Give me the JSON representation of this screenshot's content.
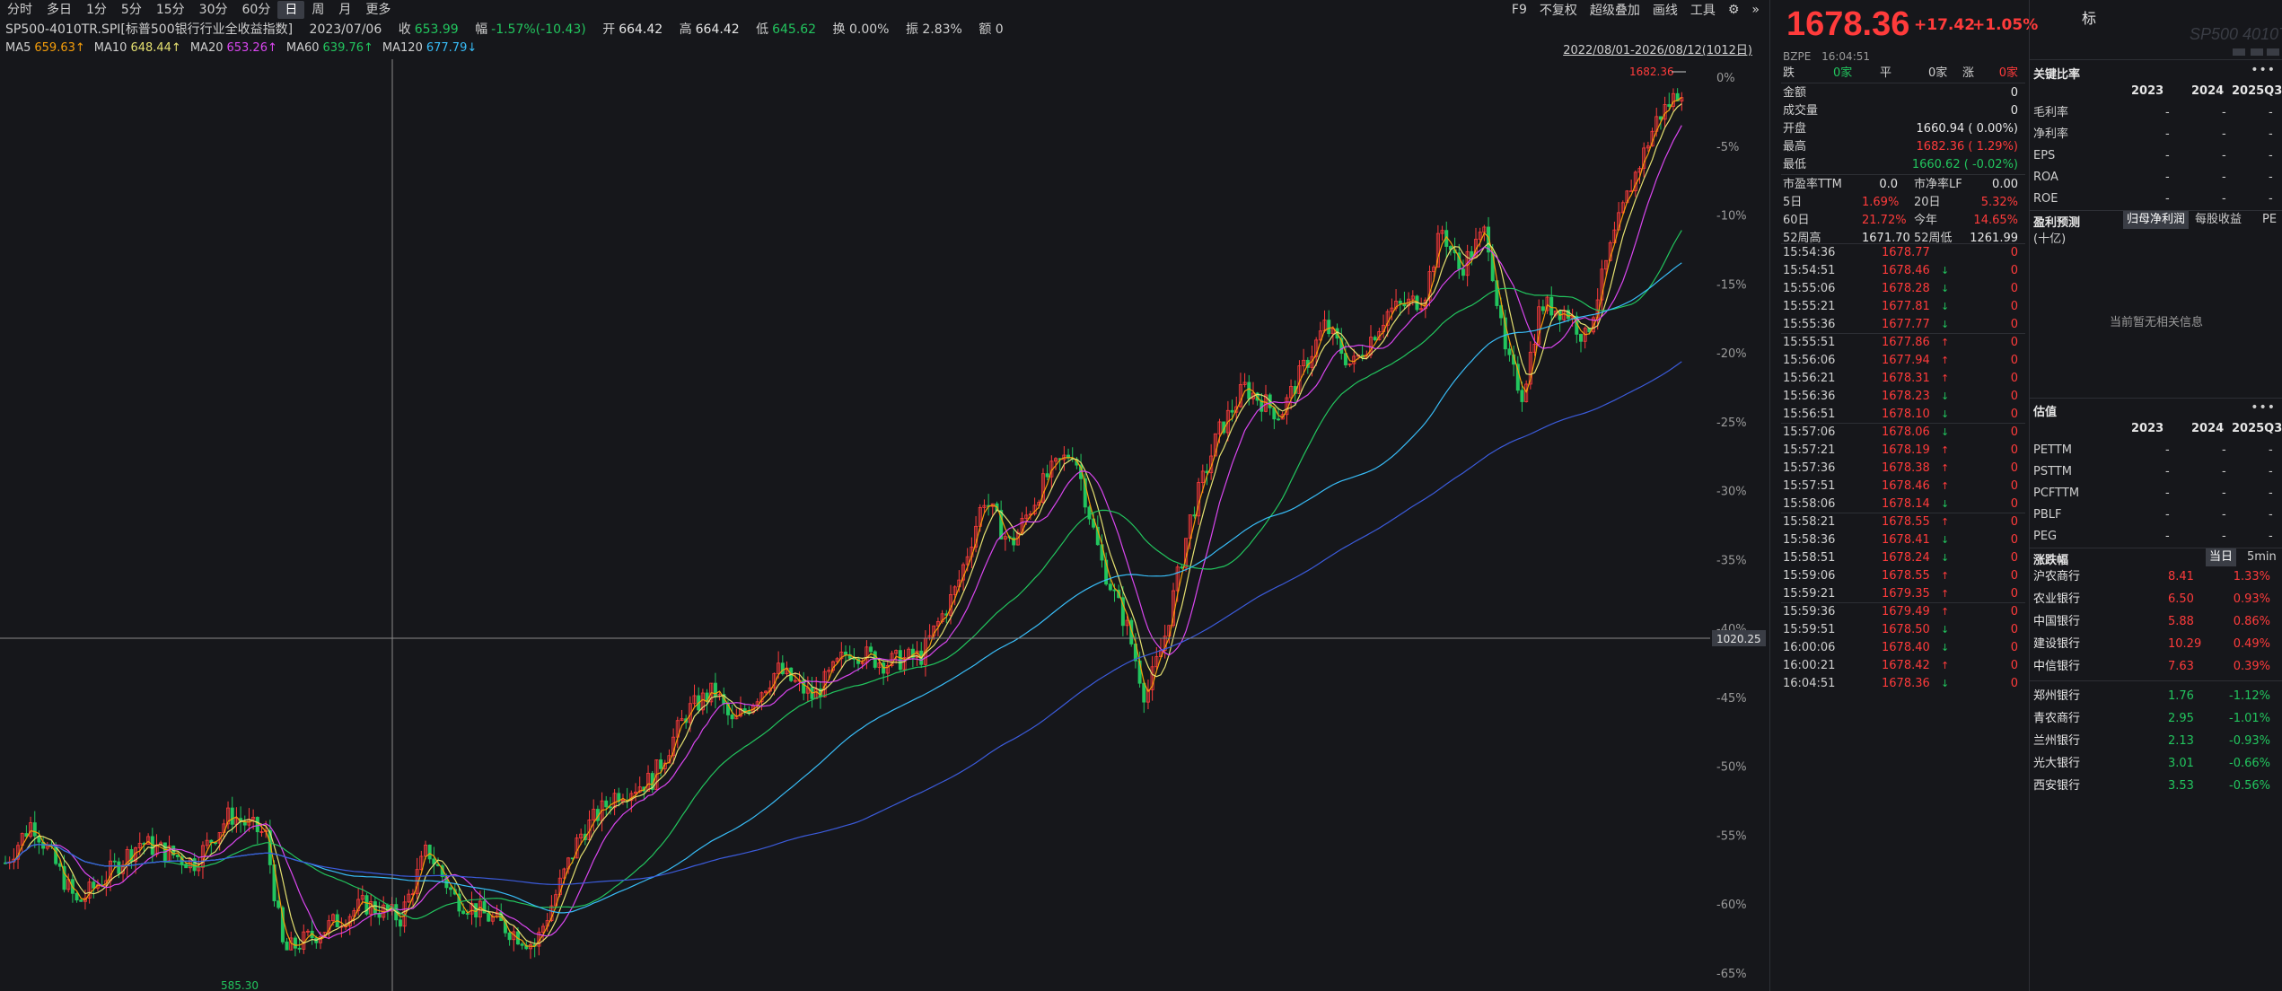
{
  "toolbar": {
    "periods": [
      "分时",
      "多日",
      "1分",
      "5分",
      "15分",
      "30分",
      "60分",
      "日",
      "周",
      "月",
      "更多"
    ],
    "active_period": "日",
    "tools": [
      "F9",
      "不复权",
      "超级叠加",
      "画线",
      "工具"
    ]
  },
  "info": {
    "symbol": "SP500-4010TR.SPI[标普500银行行业全收益指数]",
    "date": "2023/07/06",
    "close_label": "收",
    "close": "653.99",
    "amp_label": "幅",
    "change": "-1.57%(-10.43)",
    "open_label": "开",
    "open": "664.42",
    "high_label": "高",
    "high": "664.42",
    "low_label": "低",
    "low": "645.62",
    "turnover": "换 0.00%",
    "amplitude": "振 2.83%",
    "amount": "额 0"
  },
  "ma": [
    {
      "label": "MA5",
      "value": "659.63↑",
      "color": "#f59e0b"
    },
    {
      "label": "MA10",
      "value": "648.44↑",
      "color": "#e5e070"
    },
    {
      "label": "MA20",
      "value": "653.26↑",
      "color": "#d946ef"
    },
    {
      "label": "MA60",
      "value": "639.76↑",
      "color": "#22c55e"
    },
    {
      "label": "MA120",
      "value": "677.79↓",
      "color": "#38bdf8"
    }
  ],
  "range_label": "2022/08/01-2026/08/12(1012日)",
  "chart": {
    "y_ticks": [
      "0%",
      "-5%",
      "-10%",
      "-15%",
      "-20%",
      "-25%",
      "-30%",
      "-35%",
      "-40%",
      "-45%",
      "-50%",
      "-55%",
      "-60%",
      "-65%"
    ],
    "max_label": "1682.36",
    "min_label": "585.30",
    "crosshair_label": "1020.25",
    "colors": {
      "up": "#ff3b3b",
      "down": "#22c55e",
      "ma5": "#f59e0b",
      "ma10": "#e5e070",
      "ma20": "#d946ef",
      "ma60": "#22c55e",
      "ma120": "#38bdf8",
      "ma250": "#3b5bdb"
    }
  },
  "quote": {
    "price": "1678.36",
    "change": "+17.42",
    "pct": "+1.05%",
    "code": "BZPE",
    "time": "16:04:51",
    "breadth": {
      "down_label": "跌",
      "down": "0家",
      "flat_label": "平",
      "flat": "0家",
      "up_label": "涨",
      "up": "0家"
    },
    "rows": [
      {
        "label": "金额",
        "value": "0"
      },
      {
        "label": "成交量",
        "value": "0"
      },
      {
        "label": "开盘",
        "value": "1660.94 ( 0.00%)"
      },
      {
        "label": "最高",
        "value": "1682.36 ( 1.29%)"
      },
      {
        "label": "最低",
        "value": "1660.62 ( -0.02%)"
      }
    ],
    "valuation": [
      {
        "l1": "市盈率TTM",
        "v1": "0.0",
        "l2": "市净率LF",
        "v2": "0.00"
      },
      {
        "l1": "5日",
        "v1": "1.69%",
        "l2": "20日",
        "v2": "5.32%"
      },
      {
        "l1": "60日",
        "v1": "21.72%",
        "l2": "今年",
        "v2": "14.65%"
      },
      {
        "l1": "52周高",
        "v1": "1671.70",
        "l2": "52周低",
        "v2": "1261.99"
      }
    ],
    "ticks": [
      {
        "time": "15:54:36",
        "price": "1678.77",
        "dir": "",
        "vol": "0"
      },
      {
        "time": "15:54:51",
        "price": "1678.46",
        "dir": "↓",
        "vol": "0"
      },
      {
        "time": "15:55:06",
        "price": "1678.28",
        "dir": "↓",
        "vol": "0"
      },
      {
        "time": "15:55:21",
        "price": "1677.81",
        "dir": "↓",
        "vol": "0"
      },
      {
        "time": "15:55:36",
        "price": "1677.77",
        "dir": "↓",
        "vol": "0"
      },
      {
        "time": "15:55:51",
        "price": "1677.86",
        "dir": "↑",
        "vol": "0"
      },
      {
        "time": "15:56:06",
        "price": "1677.94",
        "dir": "↑",
        "vol": "0"
      },
      {
        "time": "15:56:21",
        "price": "1678.31",
        "dir": "↑",
        "vol": "0"
      },
      {
        "time": "15:56:36",
        "price": "1678.23",
        "dir": "↓",
        "vol": "0"
      },
      {
        "time": "15:56:51",
        "price": "1678.10",
        "dir": "↓",
        "vol": "0"
      },
      {
        "time": "15:57:06",
        "price": "1678.06",
        "dir": "↓",
        "vol": "0"
      },
      {
        "time": "15:57:21",
        "price": "1678.19",
        "dir": "↑",
        "vol": "0"
      },
      {
        "time": "15:57:36",
        "price": "1678.38",
        "dir": "↑",
        "vol": "0"
      },
      {
        "time": "15:57:51",
        "price": "1678.46",
        "dir": "↑",
        "vol": "0"
      },
      {
        "time": "15:58:06",
        "price": "1678.14",
        "dir": "↓",
        "vol": "0"
      },
      {
        "time": "15:58:21",
        "price": "1678.55",
        "dir": "↑",
        "vol": "0"
      },
      {
        "time": "15:58:36",
        "price": "1678.41",
        "dir": "↓",
        "vol": "0"
      },
      {
        "time": "15:58:51",
        "price": "1678.24",
        "dir": "↓",
        "vol": "0"
      },
      {
        "time": "15:59:06",
        "price": "1678.55",
        "dir": "↑",
        "vol": "0"
      },
      {
        "time": "15:59:21",
        "price": "1679.35",
        "dir": "↑",
        "vol": "0"
      },
      {
        "time": "15:59:36",
        "price": "1679.49",
        "dir": "↑",
        "vol": "0"
      },
      {
        "time": "15:59:51",
        "price": "1678.50",
        "dir": "↓",
        "vol": "0"
      },
      {
        "time": "16:00:06",
        "price": "1678.40",
        "dir": "↓",
        "vol": "0"
      },
      {
        "time": "16:00:21",
        "price": "1678.42",
        "dir": "↑",
        "vol": "0"
      },
      {
        "time": "16:04:51",
        "price": "1678.36",
        "dir": "↓",
        "vol": "0"
      }
    ]
  },
  "fundamentals": {
    "key_ratios_title": "关键比率",
    "years": [
      "2023",
      "2024",
      "2025Q3"
    ],
    "key_ratios": [
      {
        "label": "毛利率",
        "vals": [
          "-",
          "-",
          "-"
        ]
      },
      {
        "label": "净利率",
        "vals": [
          "-",
          "-",
          "-"
        ]
      },
      {
        "label": "EPS",
        "vals": [
          "-",
          "-",
          "-"
        ]
      },
      {
        "label": "ROA",
        "vals": [
          "-",
          "-",
          "-"
        ]
      },
      {
        "label": "ROE",
        "vals": [
          "-",
          "-",
          "-"
        ]
      }
    ],
    "forecast_title": "盈利预测",
    "forecast_tabs": [
      "归母净利润",
      "每股收益",
      "PE"
    ],
    "forecast_unit": "(十亿)",
    "no_info": "当前暂无相关信息",
    "valuation_title": "估值",
    "valuation": [
      {
        "label": "PETTM",
        "vals": [
          "-",
          "-",
          "-"
        ]
      },
      {
        "label": "PSTTM",
        "vals": [
          "-",
          "-",
          "-"
        ]
      },
      {
        "label": "PCFTTM",
        "vals": [
          "-",
          "-",
          "-"
        ]
      },
      {
        "label": "PBLF",
        "vals": [
          "-",
          "-",
          "-"
        ]
      },
      {
        "label": "PEG",
        "vals": [
          "-",
          "-",
          "-"
        ]
      }
    ],
    "movers_title": "涨跌幅",
    "movers_tabs": [
      "当日",
      "5min"
    ],
    "movers": [
      {
        "name": "沪农商行",
        "price": "8.41",
        "chg": "1.33%",
        "dir": "up"
      },
      {
        "name": "农业银行",
        "price": "6.50",
        "chg": "0.93%",
        "dir": "up"
      },
      {
        "name": "中国银行",
        "price": "5.88",
        "chg": "0.86%",
        "dir": "up"
      },
      {
        "name": "建设银行",
        "price": "10.29",
        "chg": "0.49%",
        "dir": "up"
      },
      {
        "name": "中信银行",
        "price": "7.63",
        "chg": "0.39%",
        "dir": "up"
      },
      {
        "name": "郑州银行",
        "price": "1.76",
        "chg": "-1.12%",
        "dir": "down"
      },
      {
        "name": "青农商行",
        "price": "2.95",
        "chg": "-1.01%",
        "dir": "down"
      },
      {
        "name": "兰州银行",
        "price": "2.13",
        "chg": "-0.93%",
        "dir": "down"
      },
      {
        "name": "光大银行",
        "price": "3.01",
        "chg": "-0.66%",
        "dir": "down"
      },
      {
        "name": "西安银行",
        "price": "3.53",
        "chg": "-0.56%",
        "dir": "down"
      }
    ]
  }
}
